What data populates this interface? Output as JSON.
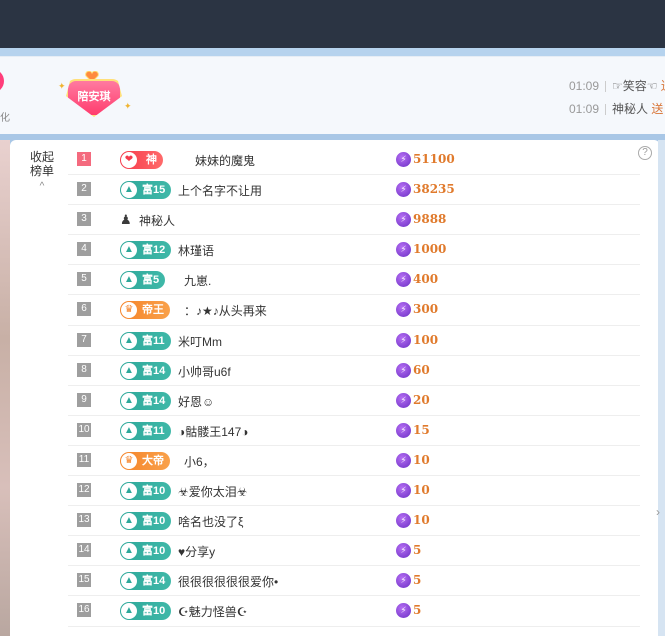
{
  "header": {
    "badge_name": "陪安琪",
    "left_clip_char": "化",
    "feed": [
      {
        "time": "01:09",
        "user": "☞笑容☜",
        "action": "送"
      },
      {
        "time": "01:09",
        "user": "神秘人",
        "action": "送"
      }
    ]
  },
  "panel": {
    "collapse_label": "收起榜单",
    "collapse_line1": "收起",
    "collapse_line2": "榜单",
    "help": "?",
    "chevron": "^"
  },
  "colors": {
    "teal_tag": "#2ea89a",
    "orange_tag": "#f5842a",
    "red_tag": "#f53a4b",
    "amount": "#e07a2c",
    "rank_first": "#f46a7e"
  },
  "rankings": [
    {
      "rank": "1",
      "tag_type": "red",
      "tag": "神",
      "name": "妹妹的魔鬼",
      "amount": "51100"
    },
    {
      "rank": "2",
      "tag_type": "teal",
      "tag": "富15",
      "name": "上个名字不让用",
      "amount": "38235"
    },
    {
      "rank": "3",
      "tag_type": "mystery",
      "tag": "",
      "name": "神秘人",
      "amount": "9888"
    },
    {
      "rank": "4",
      "tag_type": "teal",
      "tag": "富12",
      "name": "林瑾语",
      "amount": "1000"
    },
    {
      "rank": "5",
      "tag_type": "teal",
      "tag": "富5",
      "name": "九崽.",
      "amount": "400"
    },
    {
      "rank": "6",
      "tag_type": "orange",
      "tag": "帝王",
      "name": "：♪★♪从头再来",
      "amount": "300"
    },
    {
      "rank": "7",
      "tag_type": "teal",
      "tag": "富11",
      "name": "米叮Mm",
      "amount": "100"
    },
    {
      "rank": "8",
      "tag_type": "teal",
      "tag": "富14",
      "name": "小帅哥u6f",
      "amount": "60"
    },
    {
      "rank": "9",
      "tag_type": "teal",
      "tag": "富14",
      "name": "好恩☺",
      "amount": "20"
    },
    {
      "rank": "10",
      "tag_type": "teal",
      "tag": "富11",
      "name": "◑骷髅王147◑",
      "amount": "15"
    },
    {
      "rank": "11",
      "tag_type": "orange",
      "tag": "大帝",
      "name": "小6，",
      "amount": "10"
    },
    {
      "rank": "12",
      "tag_type": "teal",
      "tag": "富10",
      "name": "☣爱你太泪☣",
      "amount": "10"
    },
    {
      "rank": "13",
      "tag_type": "teal",
      "tag": "富10",
      "name": "啥名也没了ξ",
      "amount": "10"
    },
    {
      "rank": "14",
      "tag_type": "teal",
      "tag": "富10",
      "name": "♥分享y",
      "amount": "5"
    },
    {
      "rank": "15",
      "tag_type": "teal",
      "tag": "富14",
      "name": "很很很很很很爱你•",
      "amount": "5"
    },
    {
      "rank": "16",
      "tag_type": "teal",
      "tag": "富10",
      "name": "☪魅力怪兽☪",
      "amount": "5"
    }
  ]
}
